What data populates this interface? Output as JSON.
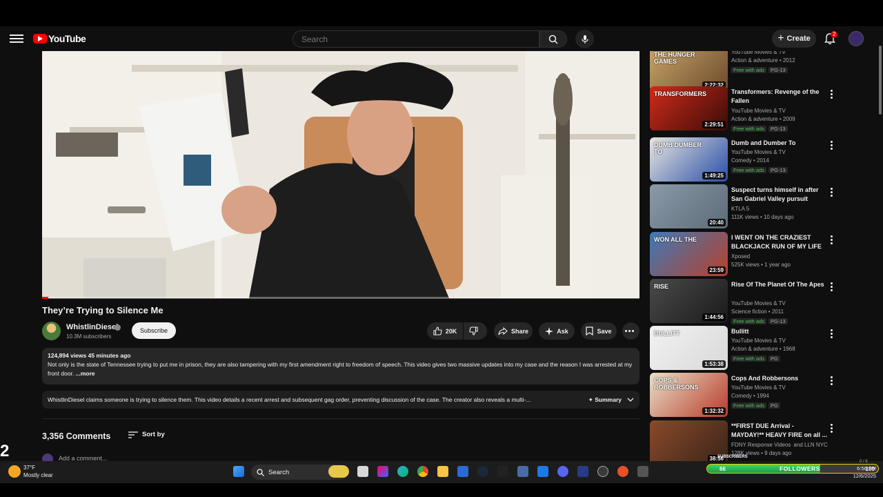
{
  "app": {
    "logo_text": "YouTube"
  },
  "masthead": {
    "search_placeholder": "Search",
    "create_label": "Create",
    "notifications_count": "2"
  },
  "video": {
    "title": "They’re Trying to Silence Me",
    "progress": 0.01,
    "channel": {
      "name": "WhistlinDiesel",
      "subscribers": "10.3M subscribers",
      "subscribe_label": "Subscribe"
    },
    "actions": {
      "likes": "20K",
      "share": "Share",
      "ask": "Ask",
      "save": "Save"
    },
    "description": {
      "stats": "124,894 views  45 minutes ago",
      "text": "Not only is the state of Tennessee trying to put me in prison, they are also tampering with my first amendment right to freedom of speech. This video gives two massive updates into my case and the reason I was arrested at my front door.",
      "more_label": " ...more"
    },
    "summary": {
      "text": "WhistlinDiesel claims someone is trying to silence them. This video details a recent arrest and subsequent gag order, preventing discussion of the case. The creator also reveals a multi-...",
      "button_label": "Summary"
    }
  },
  "comments": {
    "count": "3,356 Comments",
    "sort_label": "Sort by",
    "add_placeholder": "Add a comment..."
  },
  "recommendations": [
    {
      "title": "",
      "channel": "YouTube Movies & TV",
      "meta": "Action & adventure • 2012",
      "free": "Free with ads",
      "rating": "PG-13",
      "duration": "2:22:32",
      "thumb_text": "THE HUNGER GAMES",
      "colors": [
        "#c9a46a",
        "#6b4a2b"
      ]
    },
    {
      "title": "Transformers: Revenge of the Fallen",
      "channel": "YouTube Movies & TV",
      "meta": "Action & adventure • 2009",
      "free": "Free with ads",
      "rating": "PG-13",
      "duration": "2:29:51",
      "thumb_text": "TRANSFORMERS",
      "colors": [
        "#d12a1a",
        "#3a0c08"
      ]
    },
    {
      "title": "Dumb and Dumber To",
      "channel": "YouTube Movies & TV",
      "meta": "Comedy • 2014",
      "free": "Free with ads",
      "rating": "PG-13",
      "duration": "1:49:25",
      "thumb_text": "DUMB DUMBER TO",
      "colors": [
        "#e8e6e0",
        "#2a4fa8"
      ]
    },
    {
      "title": "Suspect turns himself in after San Gabriel Valley pursuit",
      "channel": "KTLA 5",
      "meta": "111K views • 10 days ago",
      "free": "",
      "rating": "",
      "duration": "20:40",
      "thumb_text": "",
      "colors": [
        "#8a9aa8",
        "#5d6b78"
      ]
    },
    {
      "title": "I WENT ON THE CRAZIEST BLACKJACK RUN OF MY LIFE ...",
      "channel": "Xposed",
      "meta": "525K views • 1 year ago",
      "free": "",
      "rating": "",
      "duration": "23:59",
      "thumb_text": "WON ALL THE",
      "colors": [
        "#3e7ab8",
        "#b8402a"
      ]
    },
    {
      "title": "Rise Of The Planet Of The Apes",
      "channel": "YouTube Movies & TV",
      "meta": "Science fiction • 2011",
      "free": "Free with ads",
      "rating": "PG-13",
      "duration": "1:44:56",
      "thumb_text": "RISE",
      "colors": [
        "#4a4a4a",
        "#1a1a1a"
      ]
    },
    {
      "title": "Bullitt",
      "channel": "YouTube Movies & TV",
      "meta": "Action & adventure • 1968",
      "free": "Free with ads",
      "rating": "PG",
      "duration": "1:53:38",
      "thumb_text": "BULLITT",
      "colors": [
        "#f2f2f2",
        "#d8d8d8"
      ]
    },
    {
      "title": "Cops And Robbersons",
      "channel": "YouTube Movies & TV",
      "meta": "Comedy • 1994",
      "free": "Free with ads",
      "rating": "PG",
      "duration": "1:32:32",
      "thumb_text": "COPS & ROBBERSONS",
      "colors": [
        "#e8e0c8",
        "#b83a2a"
      ]
    },
    {
      "title": "**FIRST DUE Arrival - MAYDAY!** HEAVY FIRE on all ...",
      "channel": "FDNY Response Videos",
      "meta": "128K views • 9 days ago",
      "free": "",
      "rating": "",
      "duration": "38:56",
      "thumb_text": "",
      "colors": [
        "#8a4a2a",
        "#3a2418"
      ],
      "channel_extra": "and LLN NYC"
    }
  ],
  "overlay": {
    "corner_number": "2"
  },
  "taskbar": {
    "temperature": "37°F",
    "condition": "Mostly clear",
    "search_label": "Search",
    "followers_start": "66",
    "followers_label": "FOLLOWERS",
    "followers_end": "100",
    "followers_value": 66,
    "subscribers_label": "SUBSCRIBERS",
    "ratio": "0 / 6",
    "time": "6:56 PM",
    "date": "12/6/2025"
  }
}
